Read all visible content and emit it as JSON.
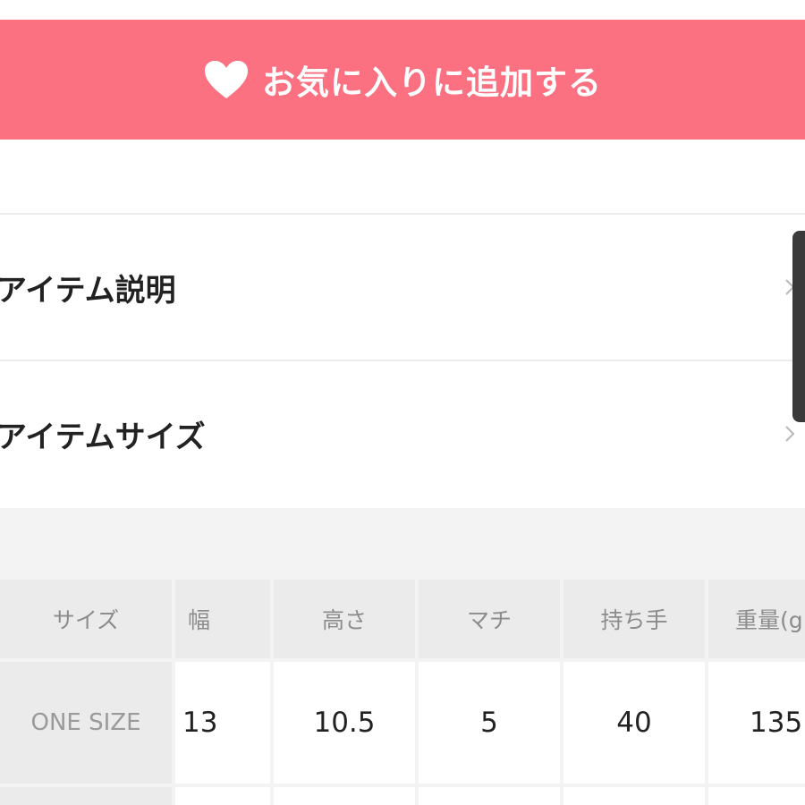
{
  "favorite_button": {
    "label": "お気に入りに追加する",
    "icon": "heart-icon",
    "background": "#fb7181",
    "text_color": "#ffffff"
  },
  "sections": [
    {
      "title": "アイテム説明",
      "icon": "chevron-right-icon"
    },
    {
      "title": "アイテムサイズ",
      "icon": "chevron-right-icon"
    }
  ],
  "size_table": {
    "headers": [
      "サイズ",
      "幅",
      "高さ",
      "マチ",
      "持ち手",
      "重量(g"
    ],
    "rows": [
      [
        "ONE SIZE",
        "13",
        "10.5",
        "5",
        "40",
        "135"
      ]
    ]
  }
}
